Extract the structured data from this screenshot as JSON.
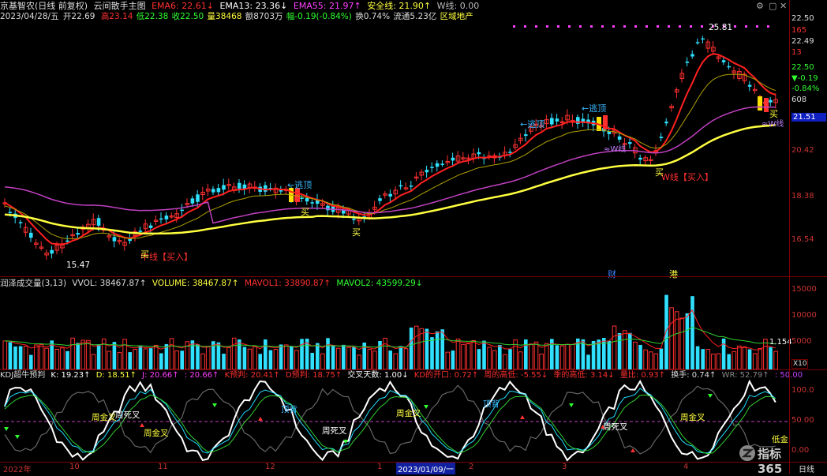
{
  "window": {
    "title": "京基智农(日线 前复权)",
    "indicator_name": "云间散手主图",
    "controls": [
      "⚙",
      "▢",
      "✕"
    ]
  },
  "main_header": {
    "ema6": "EMA6: 22.61↓",
    "ema13": "EMA13: 23.36↓",
    "ema55": "EMA55: 21.97↑",
    "safe": "安全线: 21.90↑",
    "wline": "W线: 0.00"
  },
  "quote": {
    "date": "2023/04/28/五",
    "open": "开22.69",
    "high": "高23.14",
    "low": "低22.38",
    "close": "收22.50",
    "volume": "量38468",
    "amount": "额8703万",
    "change": "幅-0.19(-0.84%)",
    "turnover": "换0.74%",
    "float": "流通5.23亿",
    "sector": "区域地产"
  },
  "price_axis": {
    "labels": [
      "22.50",
      "165",
      "22.49",
      "13",
      "22.50",
      "▼-0.19",
      "-0.84%",
      "608",
      "21.51",
      "20.42",
      "18.38",
      "16.54"
    ],
    "current": "21.51"
  },
  "main_annotations": {
    "high_mark": "25.81",
    "low_mark": "15.47",
    "escape_top": "←逃顶",
    "buy": "买",
    "mid_buy": "中线【买入】",
    "w_buy": "W线【买入】",
    "w_line": "≈W线",
    "cai": "财",
    "gang": "港"
  },
  "vol_header": {
    "name": "润泽成交量(3,13)",
    "vvol": "VVOL: 38467.87↑",
    "volume": "VOLUME: 38467.87↑",
    "mavol1": "MAVOL1: 33890.87↑",
    "mavol2": "MAVOL2: 43599.29↓"
  },
  "vol_axis": {
    "labels": [
      "15000",
      "10000",
      "5000"
    ],
    "last": "1.154",
    "unit": "X10"
  },
  "kdj_header": {
    "name": "KDJ超牛预判",
    "k": "K: 19.23↑",
    "d": "D: 18.51↑",
    "j": "J: 20.66↑",
    "v4": ": 20.66↑",
    "kpre": "K预判: 20.41↑",
    "dpre": "D预判: 18.75↑",
    "cross_days": "交叉天数: 1.00↓",
    "kd_open": "KD的开口: 0.72↑",
    "week_pos": "周的高低: -5.55↓",
    "season_pos": "季的高低: 3.14↓",
    "vol_ratio": "量比: 0.93↑",
    "turnover": "换手: 0.74↑",
    "wr": "WR: 52.79↑",
    "last": ": 50.00"
  },
  "kdj_axis": {
    "labels": [
      "100.0",
      "50.00",
      "0.00"
    ]
  },
  "kdj_annotations": {
    "zhou_jin": "周金叉",
    "zhou_si": "周死叉",
    "ding_bei": "顶背",
    "di_jin": "低金"
  },
  "time_axis": {
    "labels": [
      "2022年",
      "10",
      "11",
      "12",
      "1",
      "2023/01/09/一",
      "2",
      "3",
      "4"
    ],
    "period": "日线"
  },
  "watermark": "指标365"
}
